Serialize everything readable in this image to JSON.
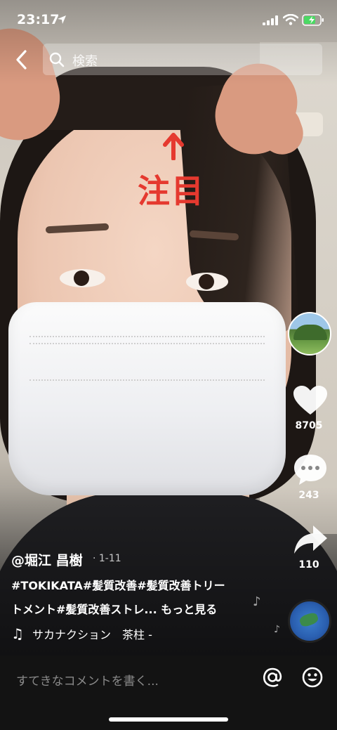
{
  "status_bar": {
    "time": "23:17"
  },
  "search": {
    "placeholder": "検索"
  },
  "video": {
    "overlay_text": "注目"
  },
  "rail": {
    "likes": "8705",
    "comments": "243",
    "shares": "110"
  },
  "caption": {
    "author": "@堀江 昌樹",
    "date": "· 1-11",
    "line1": "#TOKIKATA#髪質改善#髪質改善トリー",
    "line2": "トメント#髪質改善ストレ...",
    "more": "もっと見る"
  },
  "sound": {
    "name": "サカナクション　茶柱 -"
  },
  "comment": {
    "placeholder": "すてきなコメントを書く..."
  },
  "icons": {
    "back": "chevron-left-icon",
    "search": "search-icon",
    "like": "heart-icon",
    "comment": "comment-bubble-icon",
    "share": "share-arrow-icon",
    "music": "music-note-icon",
    "mention": "at-sign-icon",
    "emoji": "smiley-icon"
  },
  "colors": {
    "accent_red": "#e5392f",
    "battery_green": "#4cd964"
  }
}
